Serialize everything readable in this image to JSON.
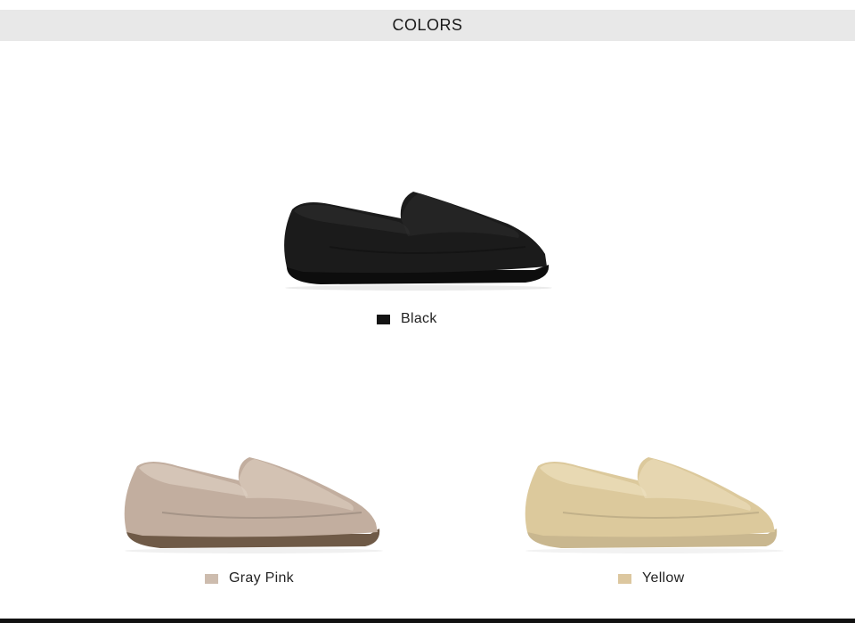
{
  "header": {
    "title": "COLORS"
  },
  "products": [
    {
      "label": "Black",
      "swatch_color": "#141414",
      "upper_color": "#1b1b1b",
      "texture_color": "#2e2e2e",
      "sole_color": "#0d0d0d"
    },
    {
      "label": "Gray Pink",
      "swatch_color": "#cdbcae",
      "upper_color": "#c2ae9f",
      "texture_color": "#ddcec2",
      "sole_color": "#6f5a47"
    },
    {
      "label": "Yellow",
      "swatch_color": "#dcc79f",
      "upper_color": "#dcc99c",
      "texture_color": "#ece0be",
      "sole_color": "#c9b78f"
    }
  ]
}
